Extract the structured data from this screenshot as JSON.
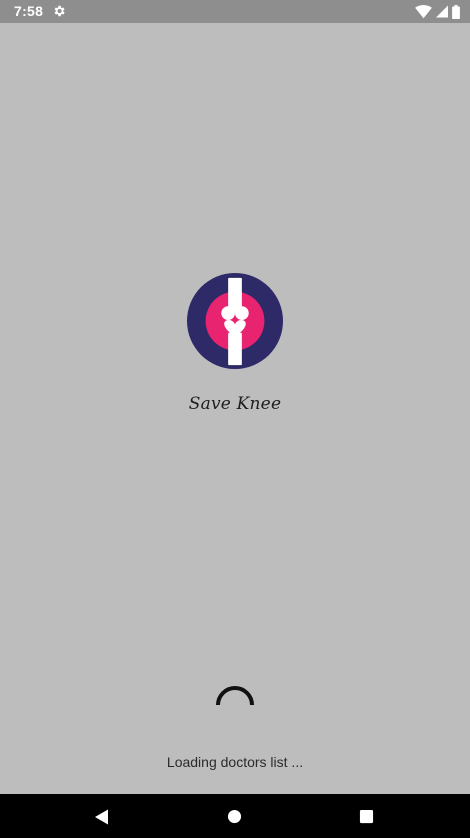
{
  "status_bar": {
    "time": "7:58",
    "icons": [
      "settings-gear-icon",
      "wifi-icon",
      "cellular-signal-icon",
      "battery-icon"
    ]
  },
  "app": {
    "name": "Save Knee",
    "logo_icon": "knee-joint-heart-logo",
    "colors": {
      "logo_outer": "#2e2a68",
      "logo_inner": "#e8236f",
      "logo_bone": "#ffffff"
    }
  },
  "loading": {
    "text": "Loading doctors list ...",
    "spinner_icon": "progress-spinner-icon"
  },
  "navigation_bar": {
    "buttons": [
      "back-icon",
      "home-icon",
      "recents-icon"
    ]
  },
  "colors": {
    "background": "#bdbdbd",
    "status_bar": "#8e8e8e",
    "nav_bar": "#000000"
  }
}
